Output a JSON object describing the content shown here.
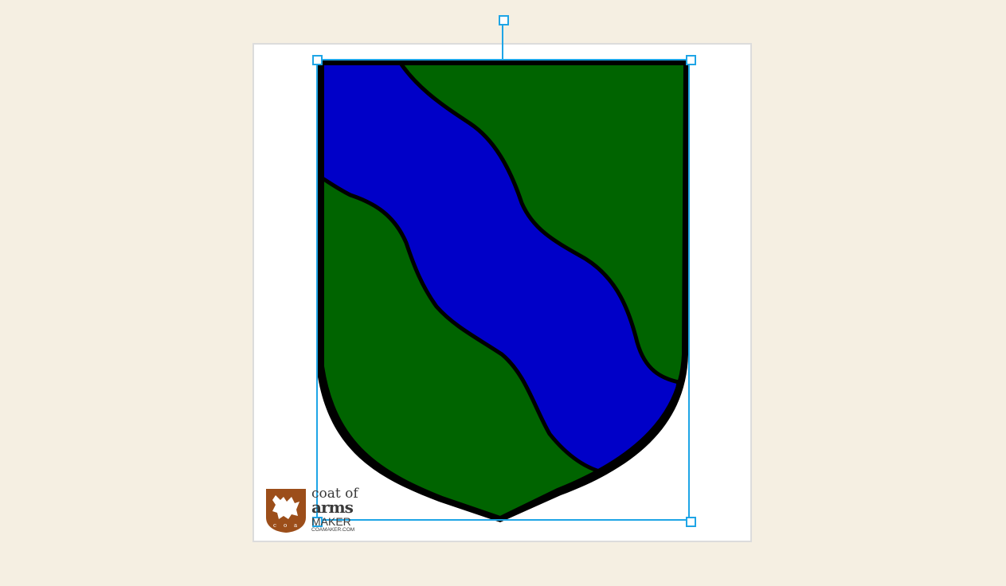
{
  "editor": {
    "canvas_background": "#ffffff",
    "page_background": "#f5efe2",
    "selection_color": "#1fa5e6"
  },
  "shield": {
    "field_tincture": "vert",
    "field_color": "#006400",
    "charge": "bend wavy",
    "charge_tincture": "azure",
    "charge_color": "#0000c8",
    "outline_color": "#000000"
  },
  "logo": {
    "line1": "coat of",
    "line2": "arms",
    "line3": "MAKER",
    "line4": "COAMAKER.COM",
    "badge_color": "#9c4e1a",
    "icon": "griffin-icon"
  }
}
